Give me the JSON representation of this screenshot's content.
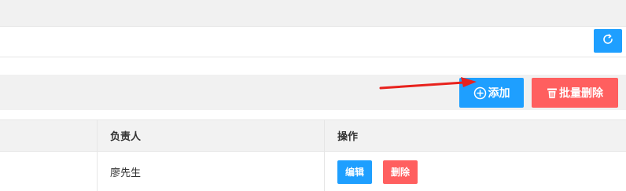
{
  "toolbar": {
    "add_label": "添加",
    "batch_delete_label": "批量删除"
  },
  "table": {
    "columns": [
      "",
      "负责人",
      "操作"
    ],
    "rows": [
      {
        "owner": "廖先生",
        "edit_label": "编辑",
        "delete_label": "删除"
      }
    ]
  },
  "colors": {
    "primary": "#1e9fff",
    "danger": "#ff5f5f",
    "annotation_arrow": "#e8221d"
  },
  "icons": {
    "refresh": "refresh-icon",
    "add": "plus-circle-icon",
    "batch_delete": "trash-icon"
  }
}
